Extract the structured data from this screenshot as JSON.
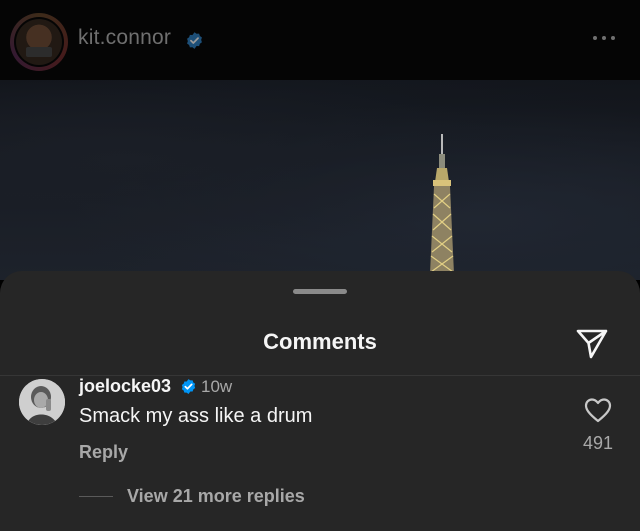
{
  "post": {
    "username": "kit.connor",
    "verified_icon": "verified-badge-icon",
    "more_icon": "more-options-icon"
  },
  "comments_sheet": {
    "title": "Comments",
    "share_icon": "paper-plane-icon"
  },
  "comment": {
    "username": "joelocke03",
    "time": "10w",
    "text": "Smack my ass like a drum",
    "reply_label": "Reply",
    "like_count": "491",
    "view_replies_label": "View 21 more replies"
  },
  "colors": {
    "sheet_background": "#262626",
    "verified_blue": "#0095f6",
    "secondary_text": "#a8a8a8"
  }
}
